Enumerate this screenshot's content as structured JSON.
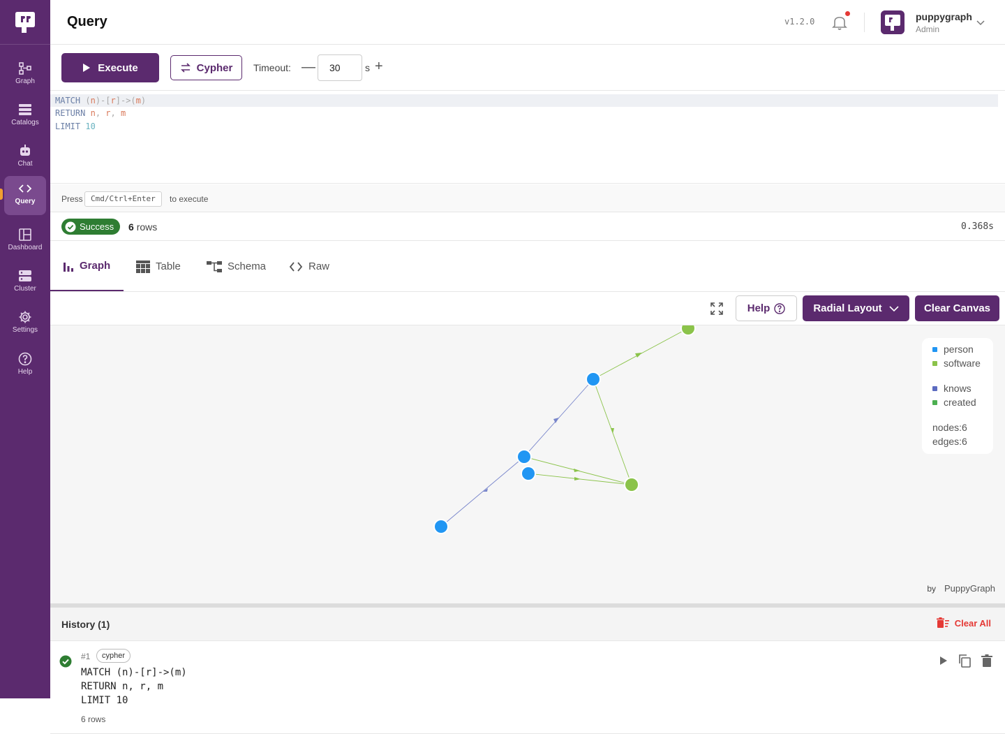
{
  "header": {
    "title": "Query",
    "version": "v1.2.0",
    "user": {
      "name": "puppygraph",
      "role": "Admin"
    }
  },
  "sidebar": {
    "items": [
      {
        "label": "Graph",
        "icon": "graph-icon"
      },
      {
        "label": "Catalogs",
        "icon": "catalogs-icon"
      },
      {
        "label": "Chat",
        "icon": "chat-bot-icon"
      },
      {
        "label": "Query",
        "icon": "code-icon",
        "active": true
      },
      {
        "label": "Dashboard",
        "icon": "dashboard-icon"
      },
      {
        "label": "Cluster",
        "icon": "cluster-icon"
      },
      {
        "label": "Settings",
        "icon": "gear-icon"
      },
      {
        "label": "Help",
        "icon": "help-icon"
      }
    ]
  },
  "toolbar": {
    "execute_label": "Execute",
    "language_label": "Cypher",
    "timeout_label": "Timeout:",
    "timeout_value": "30",
    "timeout_unit": "s"
  },
  "editor": {
    "lines": [
      "MATCH (n)-[r]->(m)",
      "RETURN n, r, m",
      "LIMIT 10"
    ]
  },
  "hint": {
    "prefix": "Press",
    "shortcut": "Cmd/Ctrl+Enter",
    "suffix": "to execute"
  },
  "status": {
    "badge": "Success",
    "row_count": "6",
    "row_unit": "rows",
    "elapsed": "0.368s"
  },
  "tabs": [
    {
      "label": "Graph",
      "icon": "bar-chart-icon",
      "active": true
    },
    {
      "label": "Table",
      "icon": "table-icon"
    },
    {
      "label": "Schema",
      "icon": "schema-icon"
    },
    {
      "label": "Raw",
      "icon": "code-icon"
    }
  ],
  "graph_toolbar": {
    "help_label": "Help",
    "layout_label": "Radial Layout",
    "clear_label": "Clear Canvas"
  },
  "legend": {
    "node_types": [
      {
        "label": "person",
        "color": "#2196f3"
      },
      {
        "label": "software",
        "color": "#8bc34a"
      }
    ],
    "edge_types": [
      {
        "label": "knows",
        "color": "#5c6bc0"
      },
      {
        "label": "created",
        "color": "#4caf50"
      }
    ],
    "nodes_stat": "nodes:6",
    "edges_stat": "edges:6"
  },
  "brand": {
    "by": "by",
    "name": "PuppyGraph"
  },
  "history": {
    "title": "History (1)",
    "clear_all_label": "Clear All",
    "items": [
      {
        "index": "#1",
        "language": "cypher",
        "lines": [
          "MATCH (n)-[r]->(m)",
          "RETURN n, r, m",
          "LIMIT 10"
        ],
        "rows": "6 rows"
      }
    ]
  },
  "colors": {
    "brand": "#5b2a6e",
    "success": "#2e7d32",
    "danger": "#e53935",
    "person": "#2196f3",
    "software": "#8bc34a"
  }
}
